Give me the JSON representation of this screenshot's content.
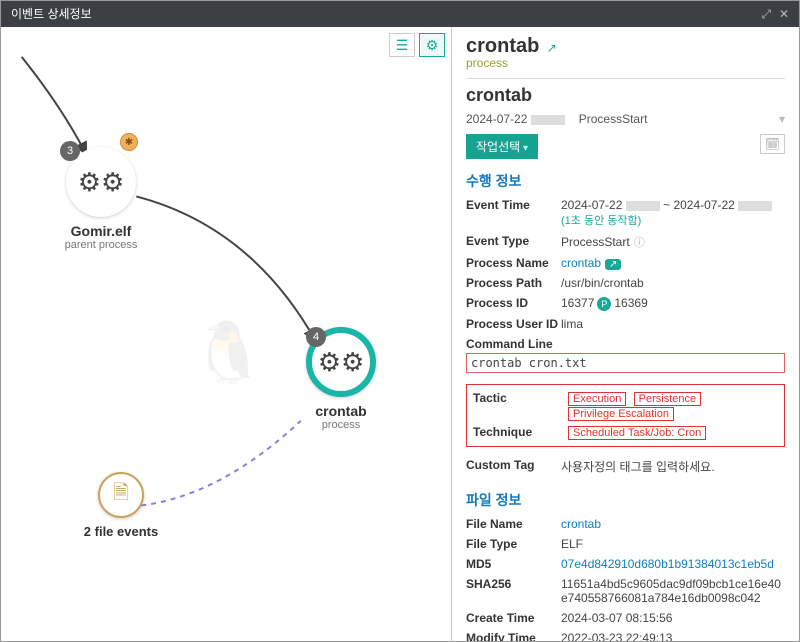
{
  "titlebar": {
    "title": "이벤트 상세정보"
  },
  "graph": {
    "parent": {
      "badge": "3",
      "name": "Gomir.elf",
      "sub": "parent process"
    },
    "child": {
      "badge": "4",
      "name": "crontab",
      "sub": "process"
    },
    "files": {
      "label": "2 file events"
    }
  },
  "side": {
    "title": "crontab",
    "type_label": "process",
    "proc_header": "crontab",
    "meta_date": "2024-07-22",
    "meta_event": "ProcessStart",
    "action_button": "작업선택",
    "exec": {
      "section": "수행 정보",
      "event_time_k": "Event Time",
      "event_time_v1": "2024-07-22",
      "event_time_sep": "~",
      "event_time_v2": "2024-07-22",
      "duration_note": "(1초 동안 동작함)",
      "event_type_k": "Event Type",
      "event_type_v": "ProcessStart",
      "proc_name_k": "Process Name",
      "proc_name_v": "crontab",
      "proc_path_k": "Process Path",
      "proc_path_v": "/usr/bin/crontab",
      "proc_id_k": "Process ID",
      "proc_id_v1": "16377",
      "proc_id_v2": "16369",
      "proc_uid_k": "Process User ID",
      "proc_uid_v": "lima",
      "cmd_k": "Command Line",
      "cmd_v": "crontab cron.txt"
    },
    "tags": {
      "tactic_k": "Tactic",
      "tactic_v": [
        "Execution",
        "Persistence",
        "Privilege Escalation"
      ],
      "technique_k": "Technique",
      "technique_v": [
        "Scheduled Task/Job: Cron"
      ],
      "custom_k": "Custom Tag",
      "custom_ph": "사용자정의 태그를 입력하세요."
    },
    "file": {
      "section": "파일 정보",
      "name_k": "File Name",
      "name_v": "crontab",
      "type_k": "File Type",
      "type_v": "ELF",
      "md5_k": "MD5",
      "md5_v": "07e4d842910d680b1b91384013c1eb5d",
      "sha_k": "SHA256",
      "sha_v": "11651a4bd5c9605dac9df09bcb1ce16e40e740558766081a784e16db0098c042",
      "ctime_k": "Create Time",
      "ctime_v": "2024-03-07 08:15:56",
      "mtime_k": "Modify Time",
      "mtime_v": "2022-03-23 22:49:13"
    }
  }
}
